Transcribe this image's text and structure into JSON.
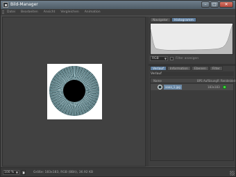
{
  "window": {
    "title": "Bild-Manager",
    "buttons": {
      "minimize": "–",
      "maximize": "□",
      "close": "✕"
    }
  },
  "menubar": {
    "items": [
      "Datei",
      "Bearbeiten",
      "Ansicht",
      "Vergleichen",
      "Animation"
    ]
  },
  "right_panel": {
    "top_tabs": [
      "Navigator",
      "Histogramm"
    ],
    "active_top_tab": "Histogramm",
    "channel_select": "RGB",
    "filter_label": "Filter anzeigen",
    "bottom_tabs": [
      "Verlauf",
      "Information",
      "Ebenen",
      "Filter"
    ],
    "active_bottom_tab": "Verlauf",
    "panel_title": "Verlauf",
    "list_headers": [
      "Name",
      "BPS",
      "Auflösung",
      "R",
      "Renderzeit"
    ],
    "rows": [
      {
        "name": "aaaa_1.jpg",
        "resolution": "183x183",
        "status_color": "#3bd63b"
      }
    ]
  },
  "statusbar": {
    "zoom": "100 %",
    "info": "Größe: 183x183, RGB (8Bit), 36.92 KB"
  },
  "icons": [
    "app-icon",
    "minimize-icon",
    "maximize-icon",
    "close-icon",
    "dropdown-arrow-icon",
    "play-icon",
    "resize-grip-icon"
  ]
}
